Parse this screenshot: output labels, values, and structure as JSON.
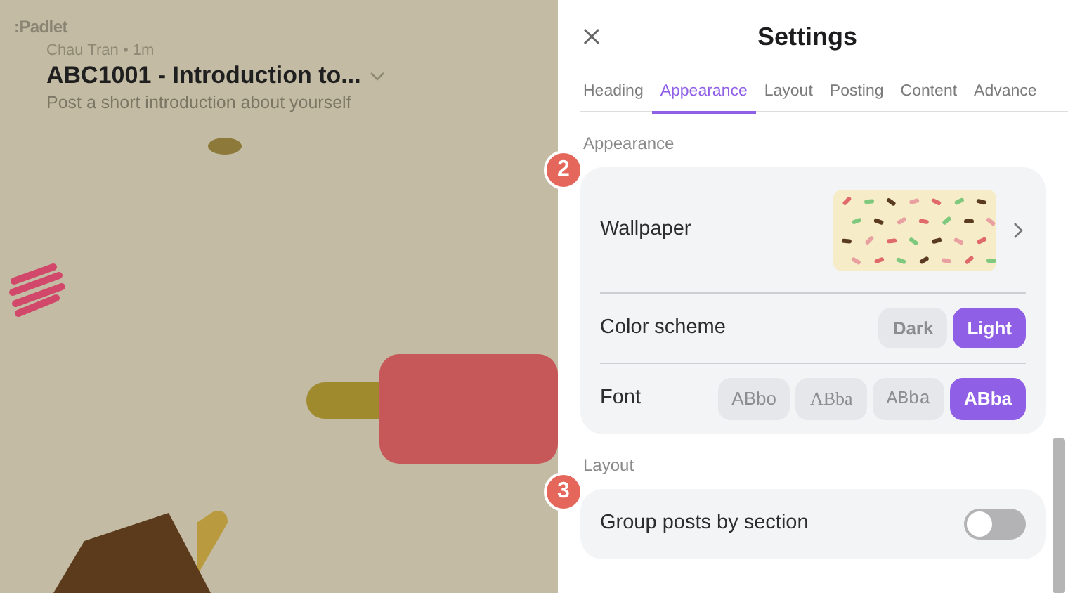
{
  "board": {
    "logo": ":Padlet",
    "author": "Chau Tran",
    "time": "• 1m",
    "title": "ABC1001 - Introduction to...",
    "description": "Post a short introduction about yourself"
  },
  "settings": {
    "title": "Settings",
    "tabs": [
      {
        "label": "Heading",
        "selected": false
      },
      {
        "label": "Appearance",
        "selected": true
      },
      {
        "label": "Layout",
        "selected": false
      },
      {
        "label": "Posting",
        "selected": false
      },
      {
        "label": "Content",
        "selected": false
      },
      {
        "label": "Advance",
        "selected": false
      }
    ],
    "sections": [
      {
        "heading": "Appearance",
        "marker": "2",
        "rows": [
          {
            "kind": "wallpaper",
            "label": "Wallpaper"
          },
          {
            "kind": "choice",
            "label": "Color scheme",
            "options": [
              {
                "label": "Dark",
                "selected": false
              },
              {
                "label": "Light",
                "selected": true
              }
            ]
          },
          {
            "kind": "font",
            "label": "Font",
            "options": [
              {
                "label": "ABbo",
                "kind": "sans",
                "selected": false
              },
              {
                "label": "ABba",
                "kind": "serif",
                "selected": false
              },
              {
                "label": "ABba",
                "kind": "mono",
                "selected": false
              },
              {
                "label": "ABba",
                "kind": "sans",
                "selected": true
              }
            ]
          }
        ]
      },
      {
        "heading": "Layout",
        "marker": "3",
        "rows": [
          {
            "kind": "toggle",
            "label": "Group posts by section",
            "on": false
          }
        ]
      }
    ]
  }
}
